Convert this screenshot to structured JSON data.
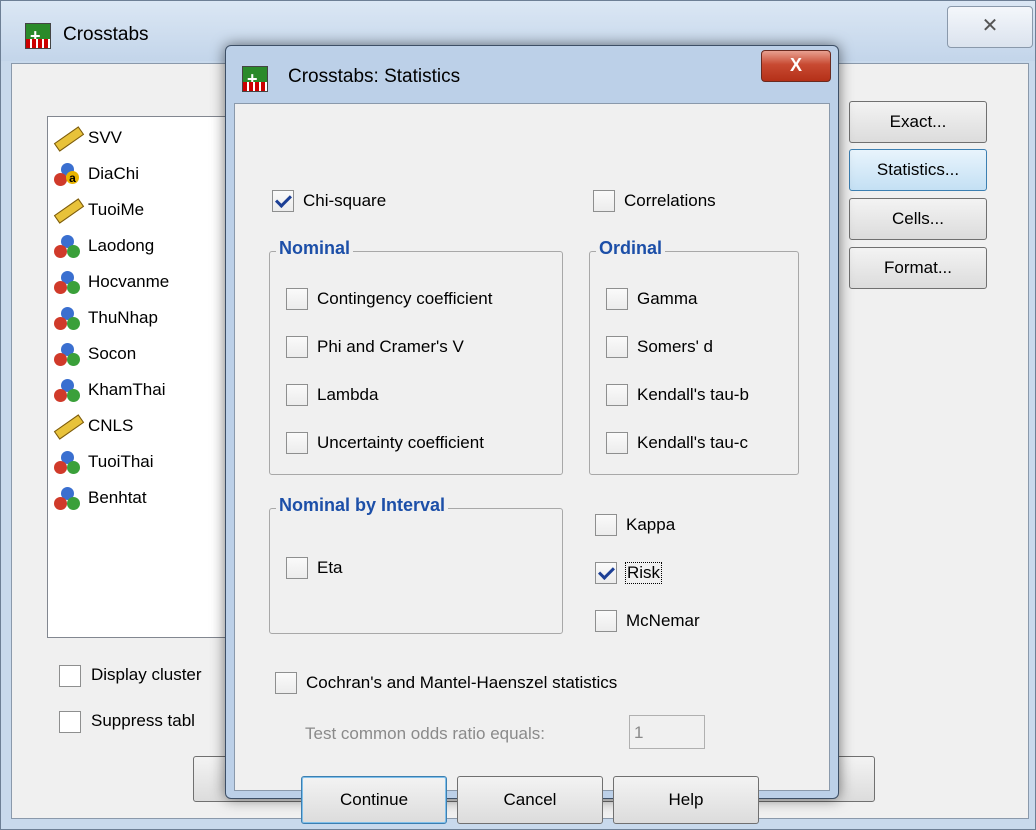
{
  "back_window": {
    "title": "Crosstabs",
    "close_glyph": "✕",
    "variables": [
      {
        "name": "SVV",
        "icon": "scale-ruler-icon"
      },
      {
        "name": "DiaChi",
        "icon": "nominal-string-icon"
      },
      {
        "name": "TuoiMe",
        "icon": "scale-ruler-icon"
      },
      {
        "name": "Laodong",
        "icon": "nominal-icon"
      },
      {
        "name": "Hocvanme",
        "icon": "nominal-icon"
      },
      {
        "name": "ThuNhap",
        "icon": "nominal-icon"
      },
      {
        "name": "Socon",
        "icon": "nominal-icon"
      },
      {
        "name": "KhamThai",
        "icon": "nominal-icon"
      },
      {
        "name": "CNLS",
        "icon": "scale-ruler-icon"
      },
      {
        "name": "TuoiThai",
        "icon": "nominal-icon"
      },
      {
        "name": "Benhtat",
        "icon": "nominal-icon"
      }
    ],
    "buttons": {
      "exact": "Exact...",
      "statistics": "Statistics...",
      "cells": "Cells...",
      "format": "Format..."
    },
    "display_clustered": "Display cluster",
    "suppress_tables": "Suppress tabl"
  },
  "dialog": {
    "title": "Crosstabs: Statistics",
    "close_glyph": "X",
    "chi_square": {
      "label": "Chi-square",
      "checked": true
    },
    "correlations": {
      "label": "Correlations",
      "checked": false
    },
    "nominal": {
      "title": "Nominal",
      "contingency": "Contingency coefficient",
      "phi": "Phi and Cramer's V",
      "lambda": "Lambda",
      "uncertainty": "Uncertainty coefficient"
    },
    "ordinal": {
      "title": "Ordinal",
      "gamma": "Gamma",
      "somers": "Somers' d",
      "tau_b": "Kendall's tau-b",
      "tau_c": "Kendall's tau-c"
    },
    "nominal_by_interval": {
      "title": "Nominal by Interval",
      "eta": "Eta"
    },
    "kappa": {
      "label": "Kappa",
      "checked": false
    },
    "risk": {
      "label": "Risk",
      "checked": true
    },
    "mcnemar": {
      "label": "McNemar",
      "checked": false
    },
    "cochran": {
      "label": "Cochran's and Mantel-Haenszel statistics",
      "checked": false
    },
    "odds_label": "Test common odds ratio equals:",
    "odds_value": "1",
    "buttons": {
      "continue": "Continue",
      "cancel": "Cancel",
      "help": "Help"
    }
  }
}
